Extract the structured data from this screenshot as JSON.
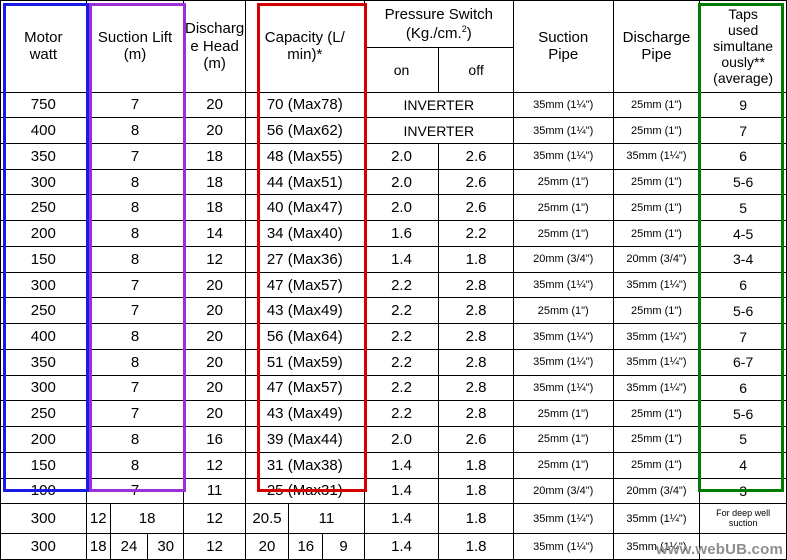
{
  "table": {
    "headers": {
      "motor_watt": "Motor\nwatt",
      "suction_lift": "Suction Lift\n(m)",
      "discharge_head": "Discharg\ne Head\n(m)",
      "capacity": "Capacity (L/\nmin)*",
      "pressure_switch": "Pressure Switch\n(Kg./cm.2)",
      "pressure_on": "on",
      "pressure_off": "off",
      "suction_pipe": "Suction\nPipe",
      "discharge_pipe": "Discharge\nPipe",
      "taps": "Taps\nused\nsimultane\nously**\n(average)"
    },
    "rows": [
      {
        "motor": "750",
        "suction": "7",
        "head": "20",
        "capacity": "70 (Max78)",
        "on": "INVERTER",
        "off": "",
        "inverter": true,
        "suction_pipe": "35mm (1¼\")",
        "discharge_pipe": "25mm (1\")",
        "taps": "9"
      },
      {
        "motor": "400",
        "suction": "8",
        "head": "20",
        "capacity": "56 (Max62)",
        "on": "INVERTER",
        "off": "",
        "inverter": true,
        "suction_pipe": "35mm (1¼\")",
        "discharge_pipe": "25mm (1\")",
        "taps": "7"
      },
      {
        "motor": "350",
        "suction": "7",
        "head": "18",
        "capacity": "48 (Max55)",
        "on": "2.0",
        "off": "2.6",
        "inverter": false,
        "suction_pipe": "35mm (1¼\")",
        "discharge_pipe": "35mm (1¼\")",
        "taps": "6"
      },
      {
        "motor": "300",
        "suction": "8",
        "head": "18",
        "capacity": "44 (Max51)",
        "on": "2.0",
        "off": "2.6",
        "inverter": false,
        "suction_pipe": "25mm (1\")",
        "discharge_pipe": "25mm (1\")",
        "taps": "5-6"
      },
      {
        "motor": "250",
        "suction": "8",
        "head": "18",
        "capacity": "40 (Max47)",
        "on": "2.0",
        "off": "2.6",
        "inverter": false,
        "suction_pipe": "25mm (1\")",
        "discharge_pipe": "25mm (1\")",
        "taps": "5"
      },
      {
        "motor": "200",
        "suction": "8",
        "head": "14",
        "capacity": "34 (Max40)",
        "on": "1.6",
        "off": "2.2",
        "inverter": false,
        "suction_pipe": "25mm (1\")",
        "discharge_pipe": "25mm (1\")",
        "taps": "4-5"
      },
      {
        "motor": "150",
        "suction": "8",
        "head": "12",
        "capacity": "27 (Max36)",
        "on": "1.4",
        "off": "1.8",
        "inverter": false,
        "suction_pipe": "20mm (3/4\")",
        "discharge_pipe": "20mm (3/4\")",
        "taps": "3-4"
      },
      {
        "motor": "300",
        "suction": "7",
        "head": "20",
        "capacity": "47 (Max57)",
        "on": "2.2",
        "off": "2.8",
        "inverter": false,
        "suction_pipe": "35mm (1¼\")",
        "discharge_pipe": "35mm (1¼\")",
        "taps": "6"
      },
      {
        "motor": "250",
        "suction": "7",
        "head": "20",
        "capacity": "43 (Max49)",
        "on": "2.2",
        "off": "2.8",
        "inverter": false,
        "suction_pipe": "25mm (1\")",
        "discharge_pipe": "25mm (1\")",
        "taps": "5-6"
      },
      {
        "motor": "400",
        "suction": "8",
        "head": "20",
        "capacity": "56 (Max64)",
        "on": "2.2",
        "off": "2.8",
        "inverter": false,
        "suction_pipe": "35mm (1¼\")",
        "discharge_pipe": "35mm (1¼\")",
        "taps": "7"
      },
      {
        "motor": "350",
        "suction": "8",
        "head": "20",
        "capacity": "51 (Max59)",
        "on": "2.2",
        "off": "2.8",
        "inverter": false,
        "suction_pipe": "35mm (1¼\")",
        "discharge_pipe": "35mm (1¼\")",
        "taps": "6-7"
      },
      {
        "motor": "300",
        "suction": "7",
        "head": "20",
        "capacity": "47 (Max57)",
        "on": "2.2",
        "off": "2.8",
        "inverter": false,
        "suction_pipe": "35mm (1¼\")",
        "discharge_pipe": "35mm (1¼\")",
        "taps": "6"
      },
      {
        "motor": "250",
        "suction": "7",
        "head": "20",
        "capacity": "43 (Max49)",
        "on": "2.2",
        "off": "2.8",
        "inverter": false,
        "suction_pipe": "25mm (1\")",
        "discharge_pipe": "25mm (1\")",
        "taps": "5-6"
      },
      {
        "motor": "200",
        "suction": "8",
        "head": "16",
        "capacity": "39 (Max44)",
        "on": "2.0",
        "off": "2.6",
        "inverter": false,
        "suction_pipe": "25mm (1\")",
        "discharge_pipe": "25mm (1\")",
        "taps": "5"
      },
      {
        "motor": "150",
        "suction": "8",
        "head": "12",
        "capacity": "31 (Max38)",
        "on": "1.4",
        "off": "1.8",
        "inverter": false,
        "suction_pipe": "25mm (1\")",
        "discharge_pipe": "25mm (1\")",
        "taps": "4"
      },
      {
        "motor": "100",
        "suction": "7",
        "head": "11",
        "capacity": "25 (Max31)",
        "on": "1.4",
        "off": "1.8",
        "inverter": false,
        "suction_pipe": "20mm (3/4\")",
        "discharge_pipe": "20mm (3/4\")",
        "taps": "3"
      }
    ],
    "split_rows": [
      {
        "motor": "300",
        "suction_parts": [
          "12",
          "18"
        ],
        "head": "12",
        "capacity_parts": [
          "20.5",
          "11"
        ],
        "on": "1.4",
        "off": "1.8",
        "suction_pipe": "35mm (1¼\")",
        "discharge_pipe": "35mm (1¼\")",
        "taps": "For deep well\nsuction"
      },
      {
        "motor": "300",
        "suction_parts": [
          "18",
          "24",
          "30"
        ],
        "head": "12",
        "capacity_parts": [
          "20",
          "16",
          "9"
        ],
        "on": "1.4",
        "off": "1.8",
        "suction_pipe": "35mm (1¼\")",
        "discharge_pipe": "35mm (1¼\")",
        "taps": ""
      }
    ]
  },
  "highlights": {
    "motor_box_color": "#1a1ae6",
    "suction_box_color": "#9b30d9",
    "capacity_box_color": "#d40000",
    "taps_box_color": "#007a00"
  },
  "watermark": "www.webUB.com"
}
